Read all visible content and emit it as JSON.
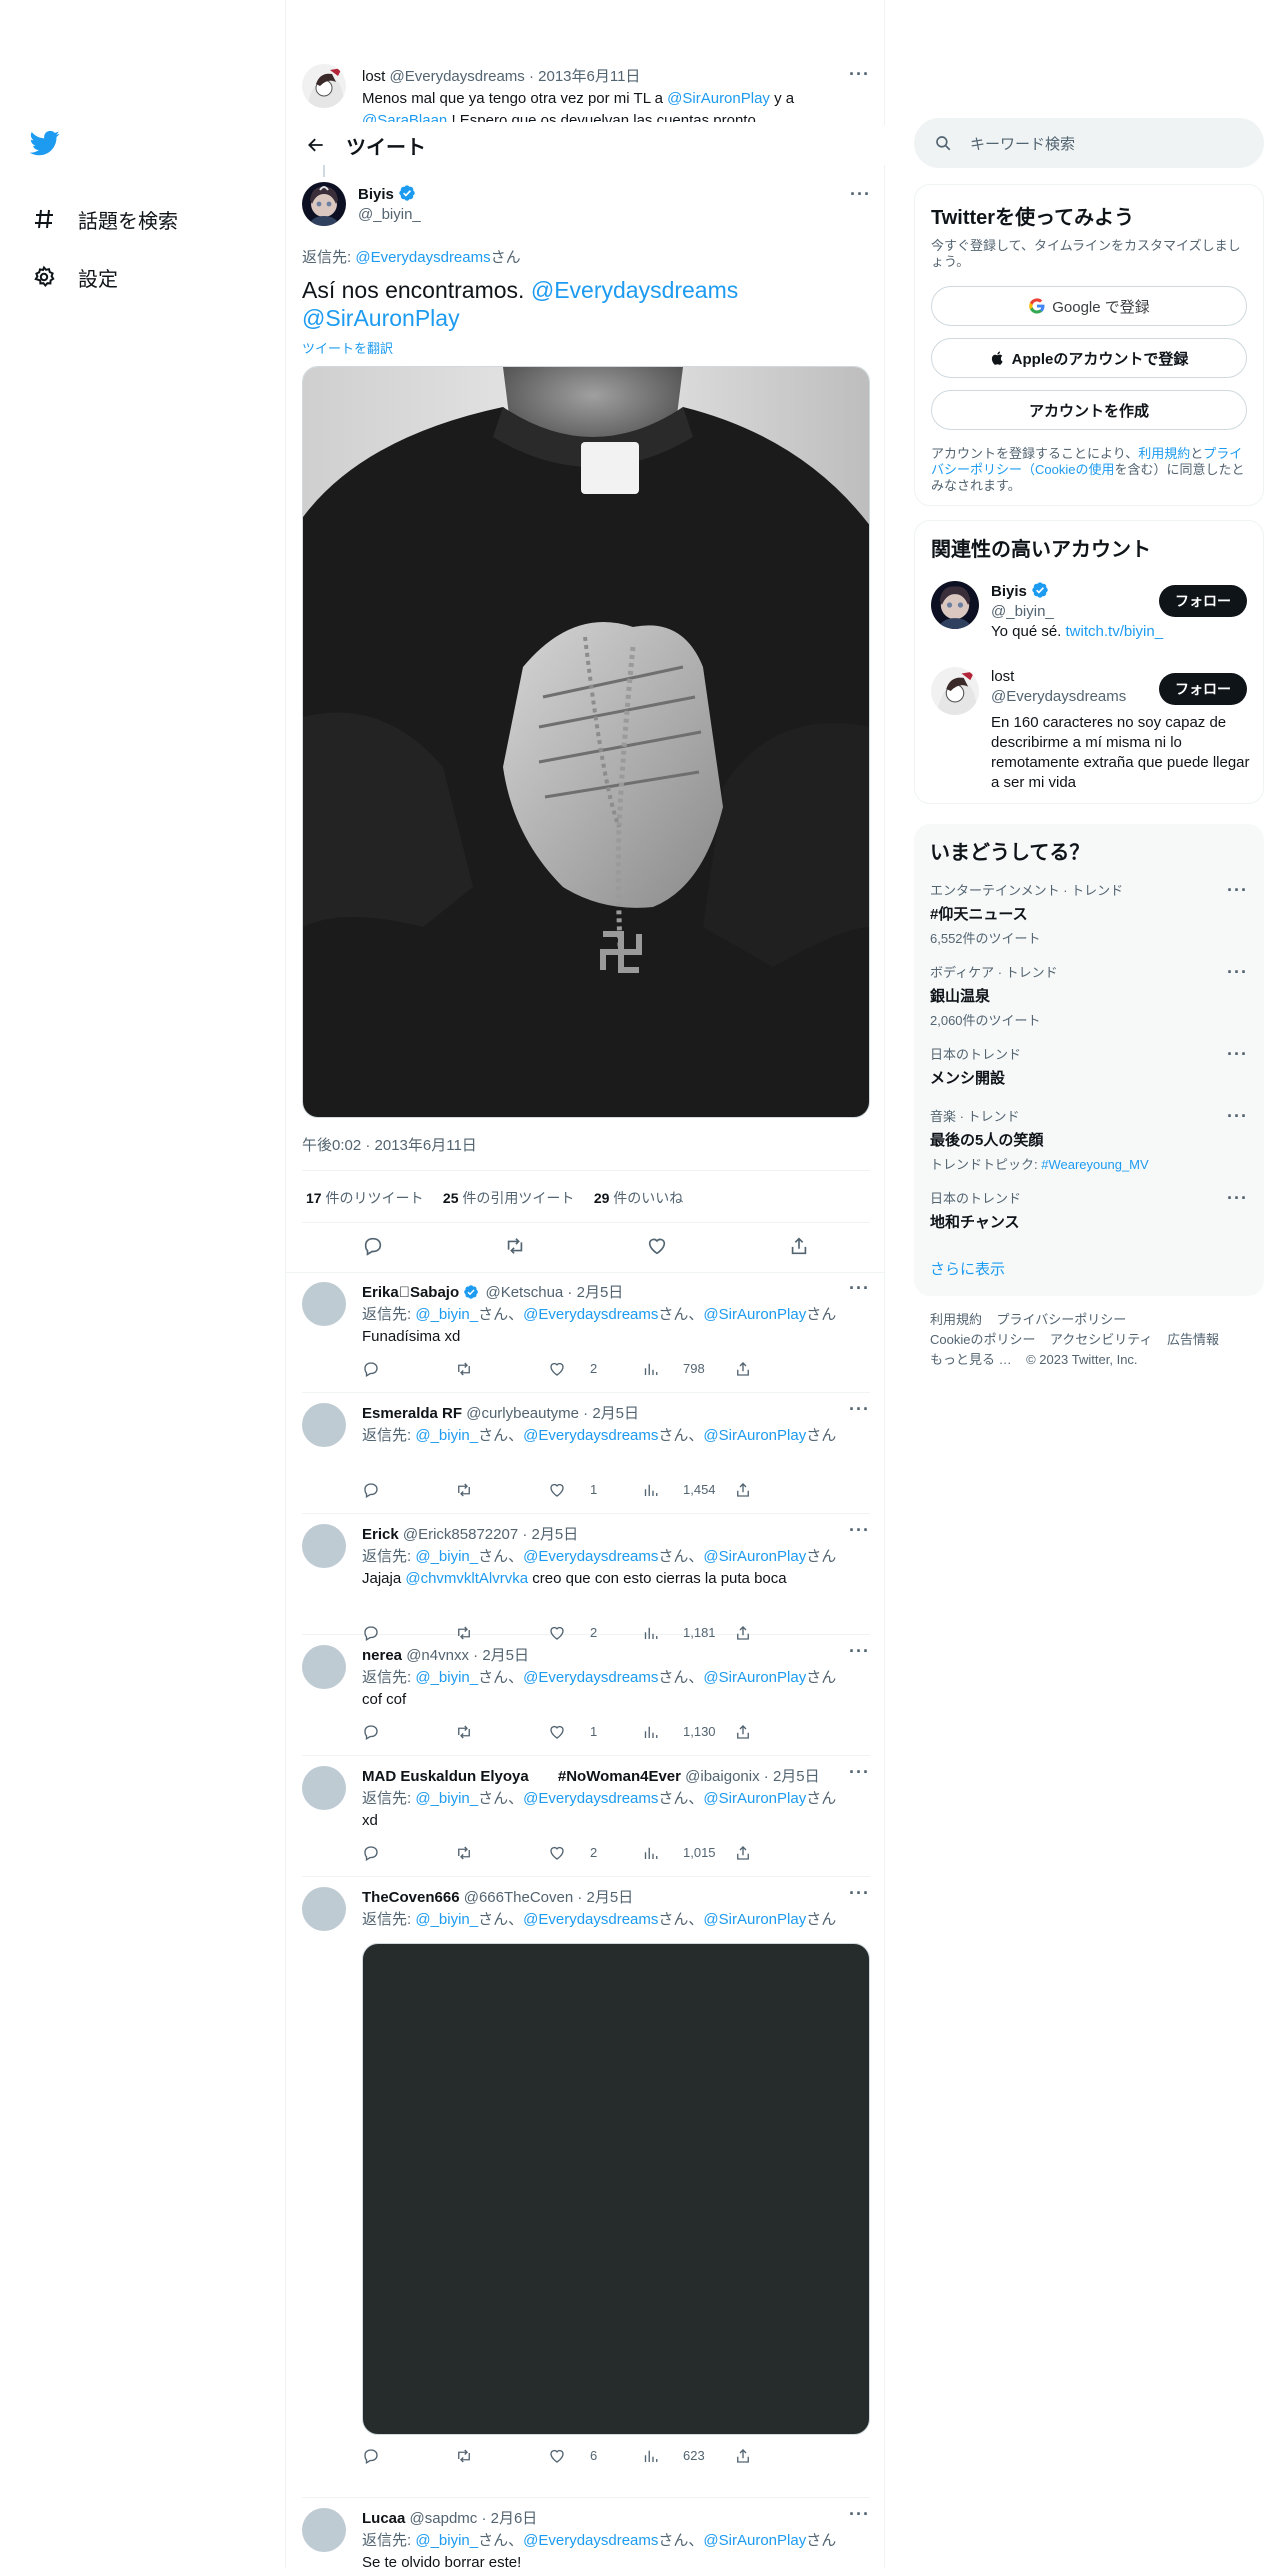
{
  "nav": {
    "explore": "話題を検索",
    "settings": "設定"
  },
  "context_tweet": {
    "name": "lost",
    "handle": "@Everydaysdreams",
    "date": "2013年6月11日",
    "text_pre": "Menos mal que ya tengo otra vez por mi TL a ",
    "mention1": "@SirAuronPlay",
    "text_mid": " y a",
    "mention2": "@SaraBlaan",
    "text_post": " ! Espero que os devuelvan las cuentas pronto"
  },
  "header": {
    "title": "ツイート"
  },
  "main_tweet": {
    "name": "Biyis",
    "handle": "@_biyin_",
    "reply_to_prefix": "返信先: ",
    "reply_to_handle": "@Everydaysdreams",
    "reply_to_suffix": "さん",
    "text": "Así nos encontramos. ",
    "mention1": "@Everydaysdreams",
    "mention2": "@SirAuronPlay",
    "translate": "ツイートを翻訳",
    "timestamp": "午後0:02 · 2013年6月11日",
    "retweets_count": "17",
    "retweets_label": " 件のリツイート",
    "quotes_count": "25",
    "quotes_label": " 件の引用ツイート",
    "likes_count": "29",
    "likes_label": " 件のいいね"
  },
  "reply_common": {
    "prefix": "返信先: ",
    "h1": "@_biyin_",
    "sep1": "さん、",
    "h2": "@Everydaysdreams",
    "sep2": "さん、",
    "h3": "@SirAuronPlay",
    "suffix": "さん"
  },
  "replies": [
    {
      "name": "Erika⃣Sabajo",
      "handle": "@Ketschua",
      "date": "2月5日",
      "text": "Funadísima xd",
      "likes": "2",
      "views": "798"
    },
    {
      "name": "Esmeralda RF",
      "handle": "@curlybeautyme",
      "date": "2月5日",
      "text": "",
      "likes": "1",
      "views": "1,454"
    },
    {
      "name": "Erick",
      "handle": "@Erick85872207",
      "date": "2月5日",
      "text_pre": "Jajaja ",
      "mention": "@chvmvkltAlvrvka",
      "text_post": " creo que con esto cierras la puta boca",
      "likes": "2",
      "views": "1,181"
    },
    {
      "name": "nerea",
      "handle": "@n4vnxx",
      "date": "2月5日",
      "text": "cof cof",
      "likes": "1",
      "views": "1,130"
    },
    {
      "name": "MAD Euskaldun Elyoya       #NoWoman4Ever",
      "handle": "@ibaigonix",
      "date": "2月5日",
      "text": "xd",
      "likes": "2",
      "views": "1,015"
    },
    {
      "name": "TheCoven666",
      "handle": "@666TheCoven",
      "date": "2月5日",
      "text": "",
      "likes": "6",
      "views": "623"
    },
    {
      "name": "Lucaa",
      "handle": "@sapdmc",
      "date": "2月6日",
      "text": "Se te olvido borrar este!"
    }
  ],
  "search": {
    "placeholder": "キーワード検索"
  },
  "signup": {
    "title": "Twitterを使ってみよう",
    "subtitle": "今すぐ登録して、タイムラインをカスタマイズしましょう。",
    "google": "Google で登録",
    "apple": "Appleのアカウントで登録",
    "create": "アカウントを作成",
    "legal_pre": "アカウントを登録することにより、",
    "terms": "利用規約",
    "and": "と",
    "privacy": "プライバシーポリシー（Cookieの使用",
    "legal_post": "を含む）に同意したとみなされます。"
  },
  "related": {
    "title": "関連性の高いアカウント",
    "accounts": [
      {
        "name": "Biyis",
        "handle": "@_biyin_",
        "bio_pre": "Yo qué sé. ",
        "bio_link": "twitch.tv/biyin_",
        "follow": "フォロー"
      },
      {
        "name": "lost",
        "handle": "@Everydaysdreams",
        "bio": "En 160 caracteres no soy capaz de describirme a mí misma ni lo remotamente extraña que puede llegar a ser mi vida",
        "follow": "フォロー"
      }
    ]
  },
  "trends": {
    "title": "いまどうしてる？",
    "items": [
      {
        "cat": "エンターテインメント · トレンド",
        "name": "#仰天ニュース",
        "count": "6,552件のツイート"
      },
      {
        "cat": "ボディケア · トレンド",
        "name": "銀山温泉",
        "count": "2,060件のツイート"
      },
      {
        "cat": "日本のトレンド",
        "name": "メンシ開設",
        "count": ""
      },
      {
        "cat": "音楽 · トレンド",
        "name": "最後の5人の笑顔",
        "count_pre": "トレンドトピック: ",
        "count_link": "#Weareyoung_MV"
      },
      {
        "cat": "日本のトレンド",
        "name": "地和チャンス",
        "count": ""
      }
    ],
    "show_more": "さらに表示"
  },
  "footer": {
    "terms": "利用規約",
    "privacy": "プライバシーポリシー",
    "cookie": "Cookieのポリシー",
    "accessibility": "アクセシビリティ",
    "ads": "広告情報",
    "more": "もっと見る …",
    "copyright": "© 2023 Twitter, Inc."
  },
  "colors": {
    "accent": "#1d9bf0",
    "text": "#0f1419",
    "secondary": "#536471"
  }
}
